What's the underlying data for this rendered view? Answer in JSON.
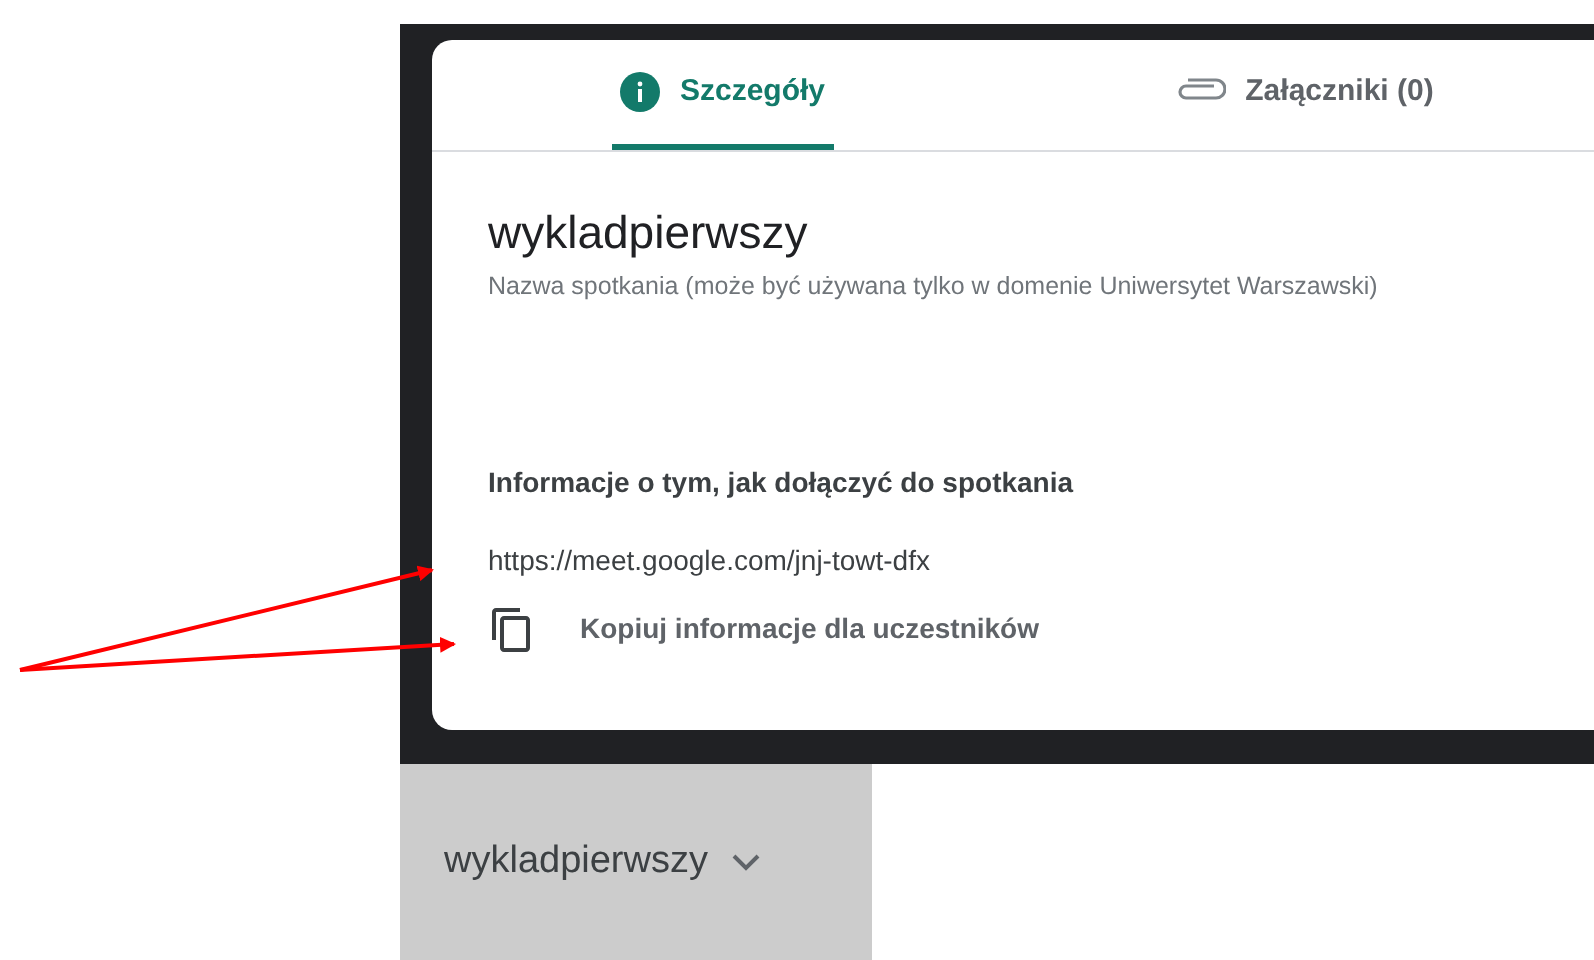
{
  "tabs": [
    {
      "label": "Szczegóły",
      "kind": "details",
      "selected": true
    },
    {
      "label": "Załączniki (0)",
      "kind": "attachments",
      "selected": false
    }
  ],
  "meeting": {
    "title": "wykladpierwszy",
    "caption": "Nazwa spotkania (może być używana tylko w domenie Uniwersytet Warszawski)"
  },
  "join_info": {
    "heading": "Informacje o tym, jak dołączyć do spotkania",
    "link": "https://meet.google.com/jnj-towt-dfx",
    "copy_button": "Kopiuj informacje dla uczestników"
  },
  "dropdown": {
    "value": "wykladpierwszy"
  }
}
